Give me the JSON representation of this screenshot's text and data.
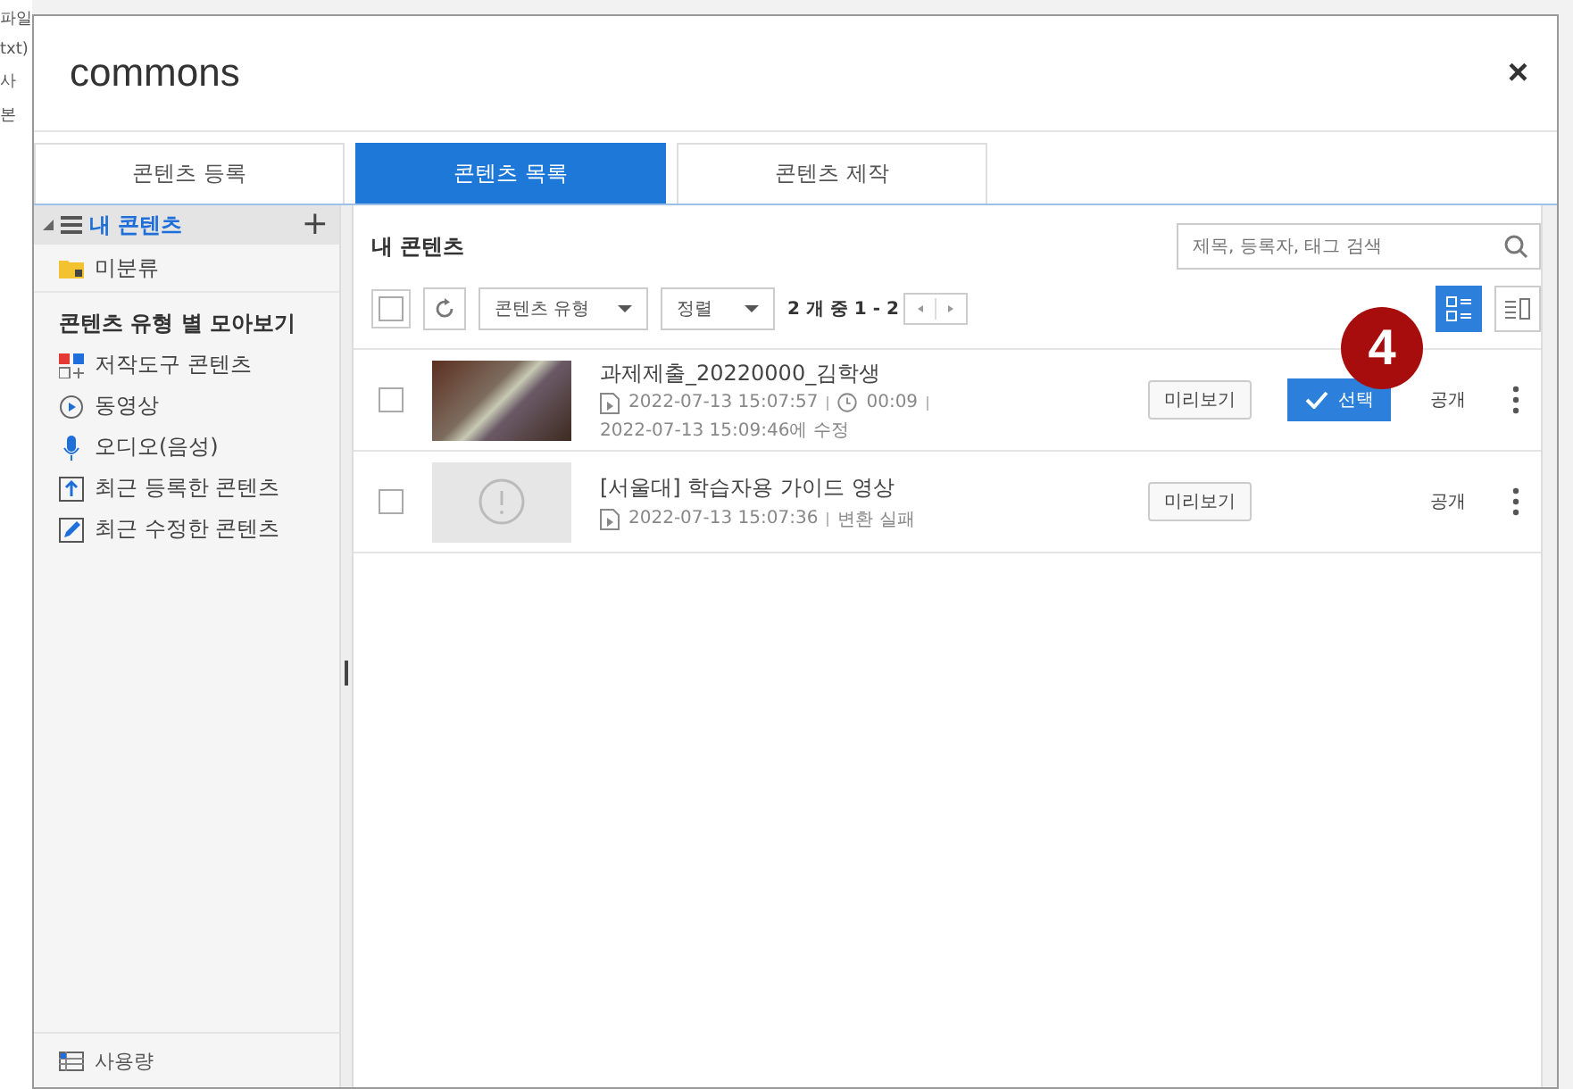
{
  "background_window": {
    "fragments": [
      "파일",
      "txt)",
      "사",
      "본"
    ]
  },
  "dialog": {
    "title": "commons",
    "close": "×"
  },
  "tabs": [
    {
      "label": "콘텐츠 등록",
      "selected": false
    },
    {
      "label": "콘텐츠 목록",
      "selected": true
    },
    {
      "label": "콘텐츠 제작",
      "selected": false
    }
  ],
  "sidebar": {
    "root": {
      "label": "내 콘텐츠",
      "expanded": true,
      "add": "+"
    },
    "folders": [
      {
        "label": "미분류",
        "kind": "folder"
      }
    ],
    "section_title": "콘텐츠 유형 별 모아보기",
    "items": [
      {
        "label": "저작도구 콘텐츠",
        "kind": "tool"
      },
      {
        "label": "동영상",
        "kind": "video"
      },
      {
        "label": "오디오(음성)",
        "kind": "audio"
      },
      {
        "label": "최근 등록한 콘텐츠",
        "kind": "upload"
      },
      {
        "label": "최근 수정한 콘텐츠",
        "kind": "edit"
      }
    ],
    "footer": "사용량"
  },
  "main": {
    "heading": "내 콘텐츠",
    "search": {
      "placeholder": "제목, 등록자, 태그 검색"
    },
    "toolbar": {
      "select_all": false,
      "type_filter": "콘텐츠 유형",
      "sort": "정렬",
      "count": "2 개 중 1 - 2",
      "views": [
        {
          "kind": "list",
          "selected": true
        },
        {
          "kind": "detail",
          "selected": false
        }
      ]
    },
    "rows": [
      {
        "title": "과제제출_20220000_김학생",
        "kind": "photo",
        "checked": false,
        "created": "2022-07-13 15:07:57",
        "duration": "00:09",
        "modified": "2022-07-13 15:09:46에 수정",
        "preview": "미리보기",
        "select": "선택",
        "visibility": "공개"
      },
      {
        "title": "[서울대] 학습자용 가이드 영상",
        "kind": "error",
        "checked": false,
        "created": "2022-07-13 15:07:36",
        "status": "변환 실패",
        "preview": "미리보기",
        "visibility": "공개"
      }
    ]
  },
  "annotation": {
    "number": "4"
  }
}
